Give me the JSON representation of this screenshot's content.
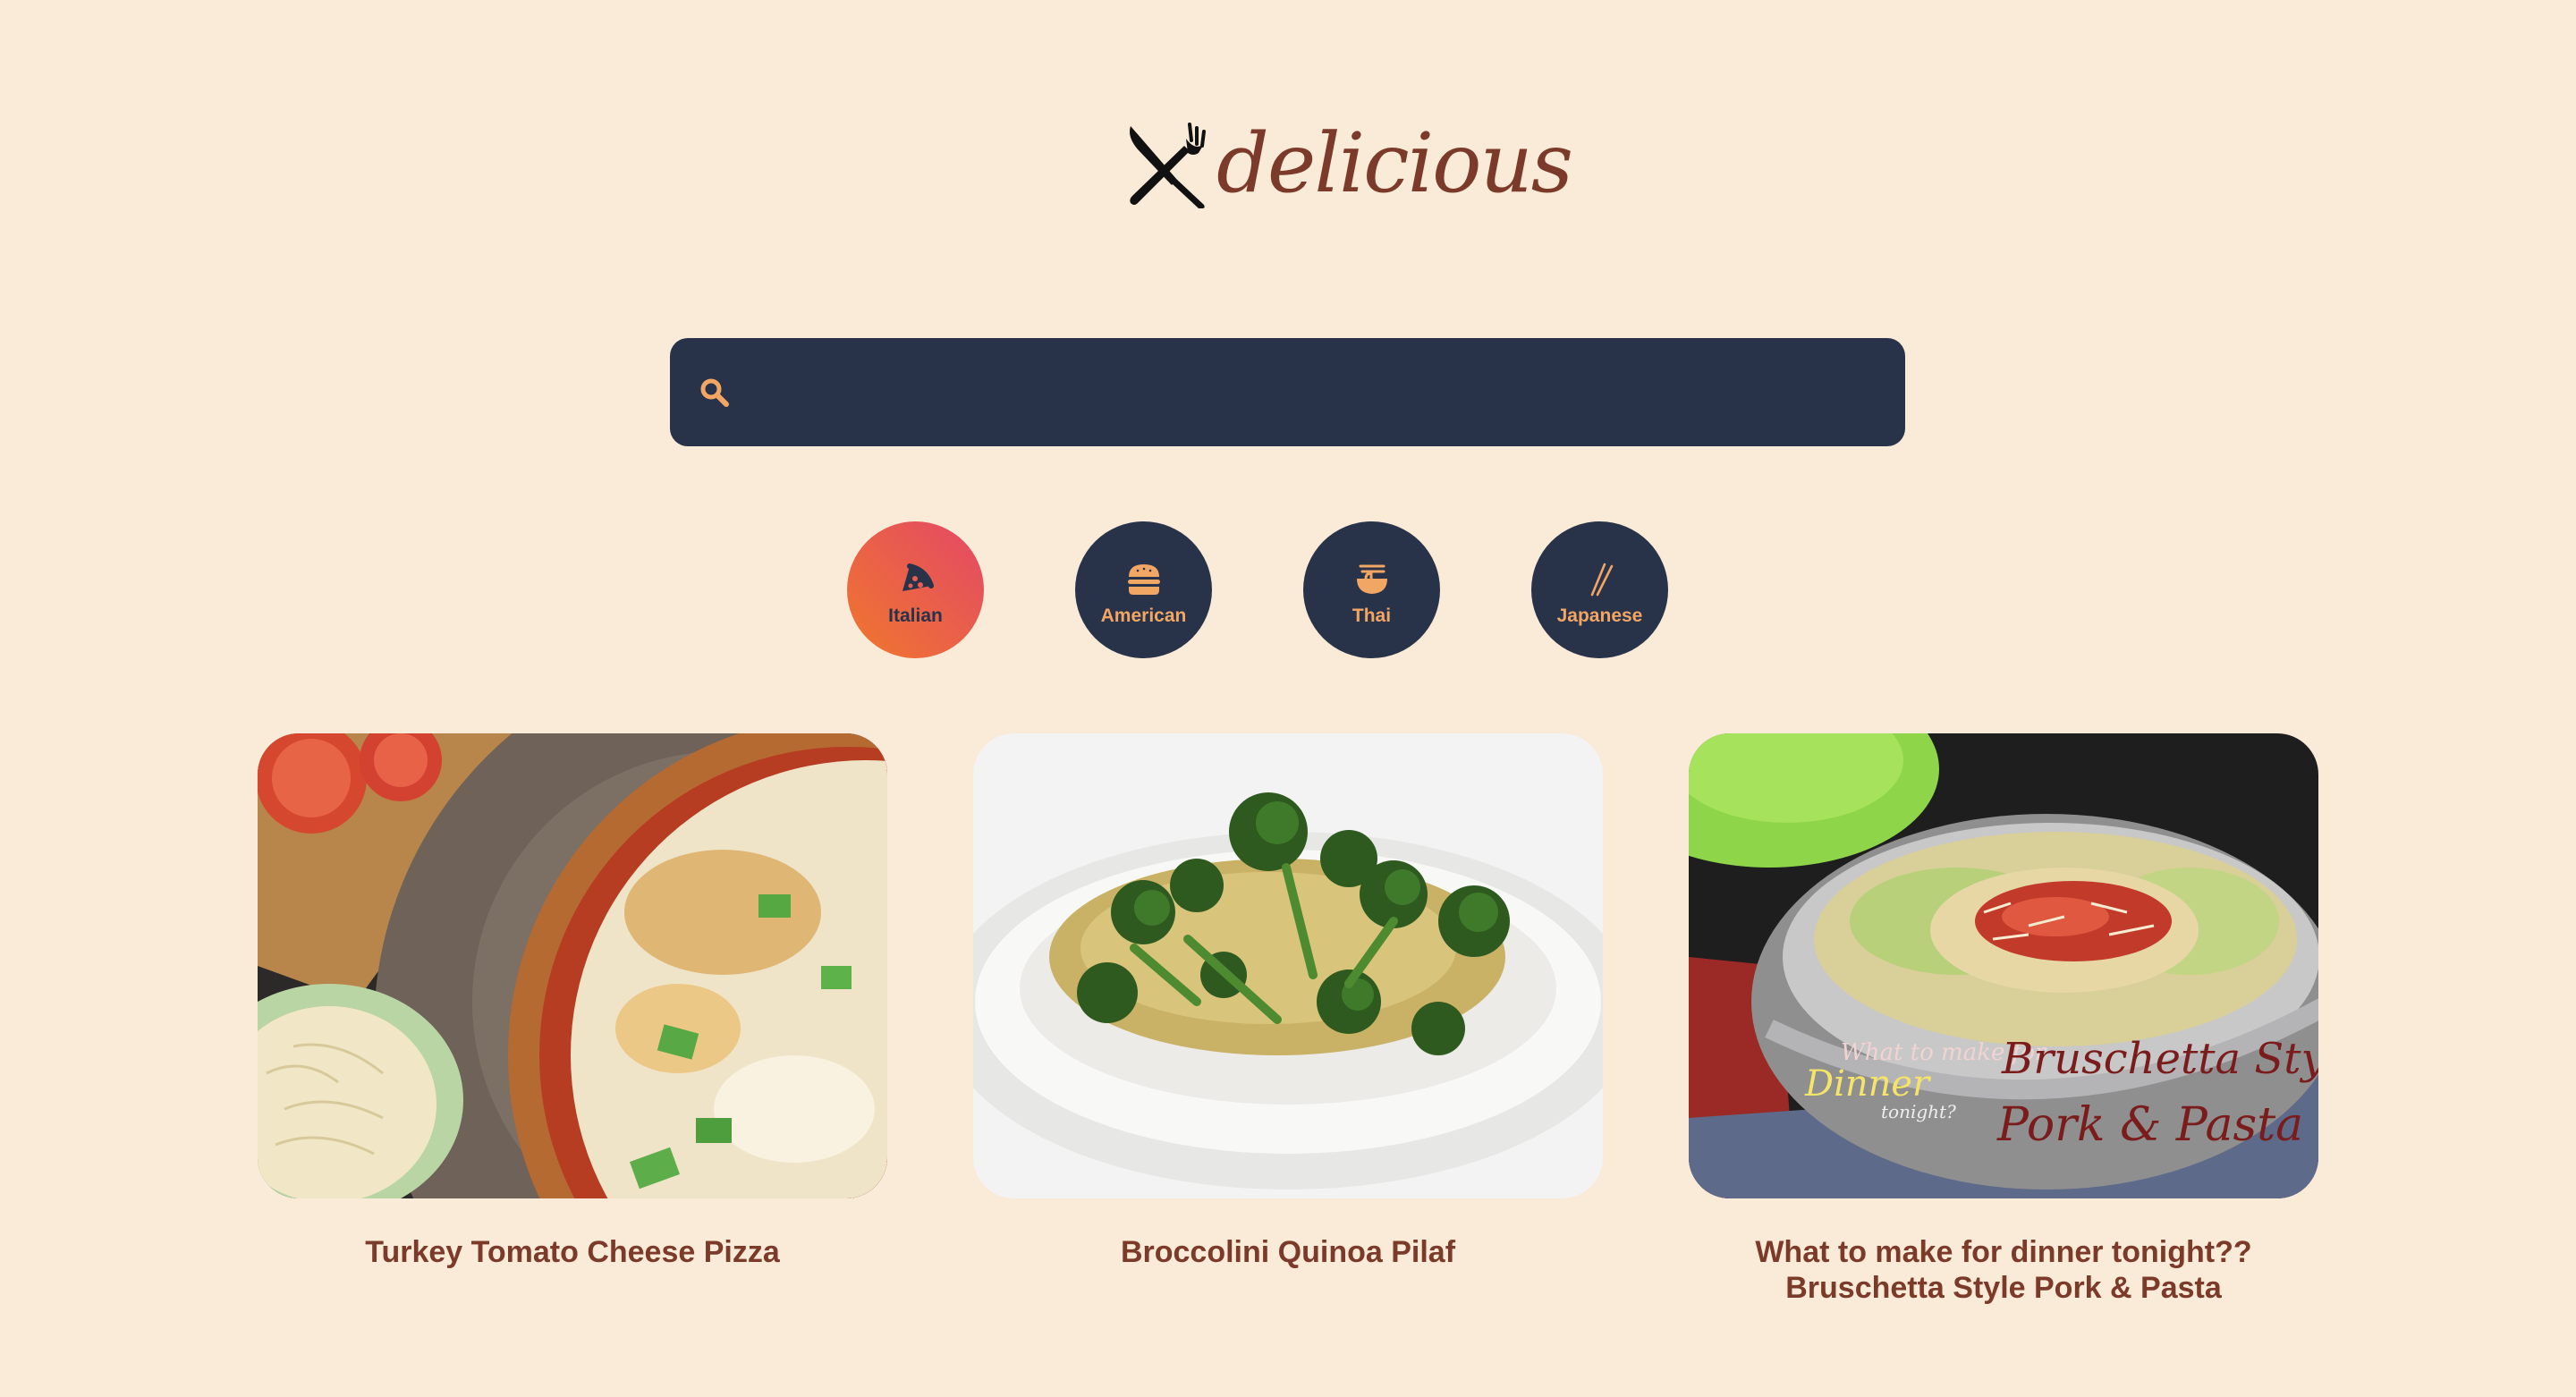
{
  "logo": {
    "text": "delicious",
    "icon": "fork-knife-crossed-icon"
  },
  "search": {
    "value": "",
    "placeholder": "",
    "icon": "search-icon"
  },
  "categories": [
    {
      "label": "Italian",
      "icon": "pizza-slice-icon",
      "active": true
    },
    {
      "label": "American",
      "icon": "hamburger-icon",
      "active": false
    },
    {
      "label": "Thai",
      "icon": "noodle-bowl-icon",
      "active": false
    },
    {
      "label": "Japanese",
      "icon": "chopsticks-icon",
      "active": false
    }
  ],
  "recipes": [
    {
      "title": "Turkey Tomato Cheese Pizza",
      "image": "pizza-photo"
    },
    {
      "title": "Broccolini Quinoa Pilaf",
      "image": "quinoa-pilaf-photo"
    },
    {
      "title": "What to make for dinner tonight?? Bruschetta Style Pork & Pasta",
      "image": "pork-pasta-photo"
    }
  ],
  "photo_overlay": {
    "line1": "What to make for",
    "line2": "Dinner",
    "line3": "tonight?",
    "line4": "Bruschetta Style",
    "line5": "Pork & Pasta"
  },
  "colors": {
    "background": "#f9ebd8",
    "navy": "#283249",
    "brand_brown": "#7c3b2a",
    "accent_orange": "#f2a663",
    "active_gradient_start": "#f0772d",
    "active_gradient_end": "#e34866"
  }
}
